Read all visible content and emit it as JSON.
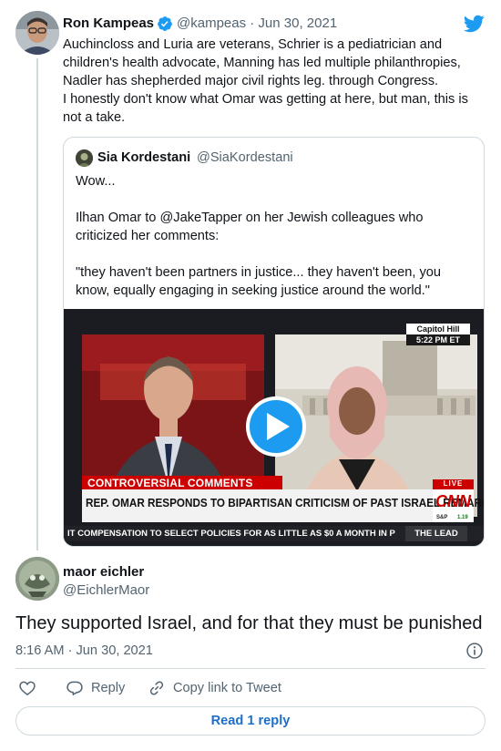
{
  "parent_tweet": {
    "author_name": "Ron Kampeas",
    "handle_date": "@kampeas · Jun 30, 2021",
    "text": "Auchincloss and Luria are veterans, Schrier is a pediatrician and\nchildren's health advocate, Manning has led multiple philanthropies,\nNadler has shepherded major civil rights leg. through Congress.\nI honestly don't know what Omar was getting at here, but man, this is\nnot a take."
  },
  "quoted_tweet": {
    "author_name": "Sia Kordestani",
    "handle": "@SiaKordestani",
    "text": "Wow...\n\nIlhan Omar to @JakeTapper on her Jewish colleagues who\ncriticized her comments:\n\n\"they haven't been partners in justice... they haven't been, you\nknow, equally engaging in seeking justice around the world.\""
  },
  "video": {
    "location_label": "Capitol Hill",
    "time_label": "5:22 PM ET",
    "segment_label": "CONTROVERSIAL COMMENTS",
    "headline": "REP. OMAR RESPONDS TO BIPARTISAN CRITICISM OF PAST ISRAEL REMARKS",
    "live_label": "LIVE",
    "network_logo": "CNN",
    "ticker_small": "S&P",
    "ticker_value": "1.19",
    "ticker": "IT COMPENSATION TO SELECT POLICIES FOR AS LITTLE AS $0 A MONTH IN P",
    "show_name": "THE LEAD"
  },
  "reply_tweet": {
    "author_name": "maor eichler",
    "handle": "@EichlerMaor",
    "text": "They supported Israel, and for that they must be punished",
    "timestamp": "8:16 AM · Jun 30, 2021"
  },
  "actions": {
    "reply_label": "Reply",
    "copy_link_label": "Copy link to Tweet"
  },
  "read_replies_label": "Read 1 reply",
  "colors": {
    "twitter_blue": "#1d9bf0",
    "text": "#0f1419",
    "secondary": "#536471",
    "border": "#cfd9de",
    "cnn_red": "#cc0000"
  }
}
